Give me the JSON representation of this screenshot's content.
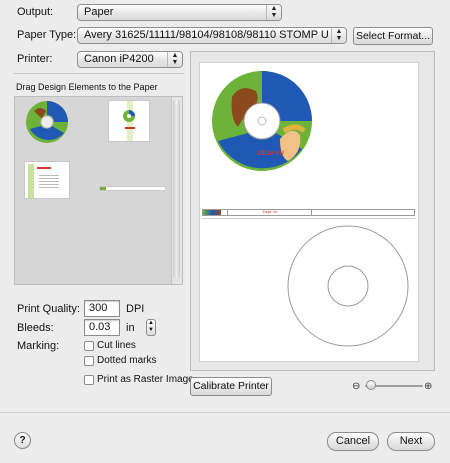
{
  "output": {
    "label": "Output:",
    "value": "Paper"
  },
  "paper_type": {
    "label": "Paper Type:",
    "value": "Avery 31625/11111/98104/98108/98110 STOMP U",
    "select_format": "Select Format..."
  },
  "printer": {
    "label": "Printer:",
    "value": "Canon iP4200"
  },
  "design_elements": {
    "header": "Drag Design Elements to the Paper"
  },
  "print_quality": {
    "label": "Print Quality:",
    "value": "300",
    "unit": "DPI"
  },
  "bleeds": {
    "label": "Bleeds:",
    "value": "0.03",
    "unit": "in"
  },
  "marking": {
    "label": "Marking:",
    "cut_lines": "Cut lines",
    "dotted_marks": "Dotted marks",
    "print_as_raster": "Print as Raster Image"
  },
  "preview": {
    "disc_label": "DEJA VU",
    "strip_label": "Deja Vu"
  },
  "calibrate": "Calibrate Printer",
  "help": "?",
  "cancel": "Cancel",
  "next": "Next",
  "colors": {
    "accent": "#2a6ad8",
    "disc_green": "#6db33a",
    "disc_blue": "#1f58b5",
    "disc_brown": "#8a4a1c"
  }
}
